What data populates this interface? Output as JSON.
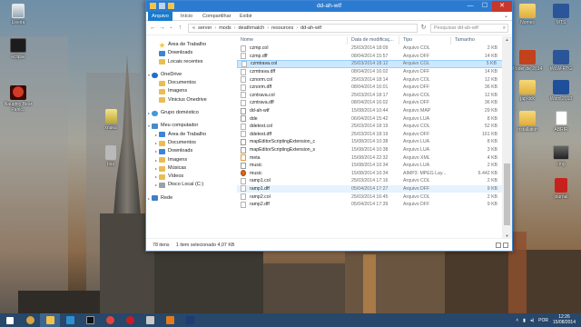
{
  "window": {
    "title": "dd-ah-wtf",
    "controls": {
      "minimize": "—",
      "maximize": "☐",
      "close": "✕"
    }
  },
  "ribbon": {
    "tabs": [
      "Arquivo",
      "Início",
      "Compartilhar",
      "Exibir"
    ],
    "expand": "⌄"
  },
  "address": {
    "back": "←",
    "forward": "→",
    "recent": "⌄",
    "up": "↑",
    "crumbs": [
      "«",
      "server",
      "mods",
      "deathmatch",
      "resources",
      "dd-ah-wtf"
    ],
    "refresh": "↻",
    "search_placeholder": "Pesquisar dd-ah-wtf",
    "search_icon": "search-icon"
  },
  "nav": {
    "items": [
      {
        "label": "Área de Trabalho",
        "icon": "desktop-icon",
        "indent": 1,
        "arrow": ""
      },
      {
        "label": "Downloads",
        "icon": "downloads-icon",
        "indent": 1,
        "arrow": ""
      },
      {
        "label": "Locais recentes",
        "icon": "recent-icon",
        "indent": 1,
        "arrow": ""
      },
      {
        "label": "OneDrive",
        "icon": "onedrive-icon",
        "indent": 0,
        "arrow": "▾"
      },
      {
        "label": "Documentos",
        "icon": "folder-icon",
        "indent": 1,
        "arrow": ""
      },
      {
        "label": "Imagens",
        "icon": "folder-icon",
        "indent": 1,
        "arrow": ""
      },
      {
        "label": "Vinicius Onedrive",
        "icon": "folder-icon",
        "indent": 1,
        "arrow": ""
      },
      {
        "label": "Grupo doméstico",
        "icon": "homegroup-icon",
        "indent": 0,
        "arrow": "▸"
      },
      {
        "label": "Meu computador",
        "icon": "computer-icon",
        "indent": 0,
        "arrow": "▾"
      },
      {
        "label": "Área de Trabalho",
        "icon": "desktop-icon",
        "indent": 1,
        "arrow": "▸"
      },
      {
        "label": "Documentos",
        "icon": "folder-icon",
        "indent": 1,
        "arrow": "▸"
      },
      {
        "label": "Downloads",
        "icon": "downloads-icon",
        "indent": 1,
        "arrow": "▸"
      },
      {
        "label": "Imagens",
        "icon": "folder-icon",
        "indent": 1,
        "arrow": "▸"
      },
      {
        "label": "Músicas",
        "icon": "music-folder-icon",
        "indent": 1,
        "arrow": "▸"
      },
      {
        "label": "Vídeos",
        "icon": "video-folder-icon",
        "indent": 1,
        "arrow": "▸"
      },
      {
        "label": "Disco Local (C:)",
        "icon": "drive-icon",
        "indent": 1,
        "arrow": "▸"
      },
      {
        "label": "Rede",
        "icon": "network-icon",
        "indent": 0,
        "arrow": "▸"
      }
    ]
  },
  "filelist": {
    "columns": [
      "Nome",
      "Data de modificaç...",
      "Tipo",
      "Tamanho"
    ],
    "rows": [
      {
        "name": "czmp.col",
        "date": "25/03/2014 18:09",
        "type": "Arquivo COL",
        "size": "2 KB",
        "icon": "file-icon"
      },
      {
        "name": "czmp.dff",
        "date": "08/04/2014 15:57",
        "type": "Arquivo DFF",
        "size": "14 KB",
        "icon": "file-icon"
      },
      {
        "name": "czmtrava.col",
        "date": "25/03/2014 18:12",
        "type": "Arquivo COL",
        "size": "5 KB",
        "icon": "file-icon",
        "state": "selected"
      },
      {
        "name": "czmtrava.dff",
        "date": "08/04/2014 16:02",
        "type": "Arquivo DFF",
        "size": "14 KB",
        "icon": "file-icon"
      },
      {
        "name": "cznorm.col",
        "date": "25/03/2014 18:14",
        "type": "Arquivo COL",
        "size": "12 KB",
        "icon": "file-icon"
      },
      {
        "name": "cznorm.dff",
        "date": "08/04/2014 16:01",
        "type": "Arquivo DFF",
        "size": "36 KB",
        "icon": "file-icon"
      },
      {
        "name": "czntrava.col",
        "date": "25/03/2014 18:17",
        "type": "Arquivo COL",
        "size": "12 KB",
        "icon": "file-icon"
      },
      {
        "name": "czntrava.dff",
        "date": "08/04/2014 16:02",
        "type": "Arquivo DFF",
        "size": "36 KB",
        "icon": "file-icon"
      },
      {
        "name": "dd-ah-wtf",
        "date": "15/08/2014 10:44",
        "type": "Arquivo MAP",
        "size": "29 KB",
        "icon": "map-file-icon"
      },
      {
        "name": "dde",
        "date": "06/04/2014 15:42",
        "type": "Arquivo LUA",
        "size": "8 KB",
        "icon": "lua-file-icon"
      },
      {
        "name": "ddetest.col",
        "date": "25/03/2014 18:19",
        "type": "Arquivo COL",
        "size": "52 KB",
        "icon": "file-icon"
      },
      {
        "name": "ddetest.dff",
        "date": "25/03/2014 18:19",
        "type": "Arquivo DFF",
        "size": "161 KB",
        "icon": "file-icon"
      },
      {
        "name": "mapEditorScriptingExtension_c",
        "date": "15/08/2014 10:38",
        "type": "Arquivo LUA",
        "size": "8 KB",
        "icon": "lua-file-icon"
      },
      {
        "name": "mapEditorScriptingExtension_s",
        "date": "15/08/2014 10:38",
        "type": "Arquivo LUA",
        "size": "3 KB",
        "icon": "lua-file-icon"
      },
      {
        "name": "meta",
        "date": "15/08/2014 22:32",
        "type": "Arquivo XML",
        "size": "4 KB",
        "icon": "xml-file-icon"
      },
      {
        "name": "music",
        "date": "15/08/2014 10:34",
        "type": "Arquivo LUA",
        "size": "2 KB",
        "icon": "lua-file-icon"
      },
      {
        "name": "music",
        "date": "15/08/2014 10:34",
        "type": "AIMP3: MPEG Lay...",
        "size": "6.442 KB",
        "icon": "audio-file-icon"
      },
      {
        "name": "ramp1.col",
        "date": "25/03/2014 17:16",
        "type": "Arquivo COL",
        "size": "2 KB",
        "icon": "file-icon"
      },
      {
        "name": "ramp1.dff",
        "date": "05/04/2014 17:27",
        "type": "Arquivo DFF",
        "size": "9 KB",
        "icon": "file-icon",
        "state": "hover"
      },
      {
        "name": "ramp2.col",
        "date": "25/03/2014 16:45",
        "type": "Arquivo COL",
        "size": "2 KB",
        "icon": "file-icon"
      },
      {
        "name": "ramp2.dff",
        "date": "05/04/2014 17:39",
        "type": "Arquivo DFF",
        "size": "9 KB",
        "icon": "file-icon"
      }
    ]
  },
  "status": {
    "count": "78 itens",
    "selection": "1 item selecionado  4,07 KB"
  },
  "desktop": {
    "left_icons": [
      {
        "label": "Lixeira",
        "glyph": "recycle-bin-icon"
      },
      {
        "label": "eclipse",
        "glyph": "eclipse-icon"
      },
      {
        "label": "Naughty Bear Panic..",
        "glyph": "game-icon"
      },
      {
        "label": "xnaka",
        "glyph": "file-icon"
      },
      {
        "label": "bsa",
        "glyph": "file-icon"
      }
    ],
    "right_icons": [
      {
        "label": "Nomes",
        "glyph": "folder-icon"
      },
      {
        "label": "MTS",
        "glyph": "word-icon"
      },
      {
        "label": "Poder de 2014",
        "glyph": "powerpoint-icon"
      },
      {
        "label": "WoW-RTG",
        "glyph": "word-icon"
      },
      {
        "label": "jap-tick",
        "glyph": "folder-icon"
      },
      {
        "label": "Word 2013",
        "glyph": "word-icon"
      },
      {
        "label": "Installation",
        "glyph": "folder-icon"
      },
      {
        "label": "ABRIR",
        "glyph": "document-icon"
      },
      {
        "label": "cmg",
        "glyph": "mod-icon"
      },
      {
        "label": "journal",
        "glyph": "red-cube-icon"
      }
    ]
  },
  "taskbar": {
    "apps": [
      "start-icon",
      "ie-icon",
      "explorer-icon",
      "media-icon",
      "terminal-icon",
      "chrome-icon",
      "opera-icon",
      "app-icon",
      "mta-icon",
      "photoshop-icon"
    ],
    "language": "POR",
    "time": "12:26",
    "date": "15/08/2014"
  }
}
